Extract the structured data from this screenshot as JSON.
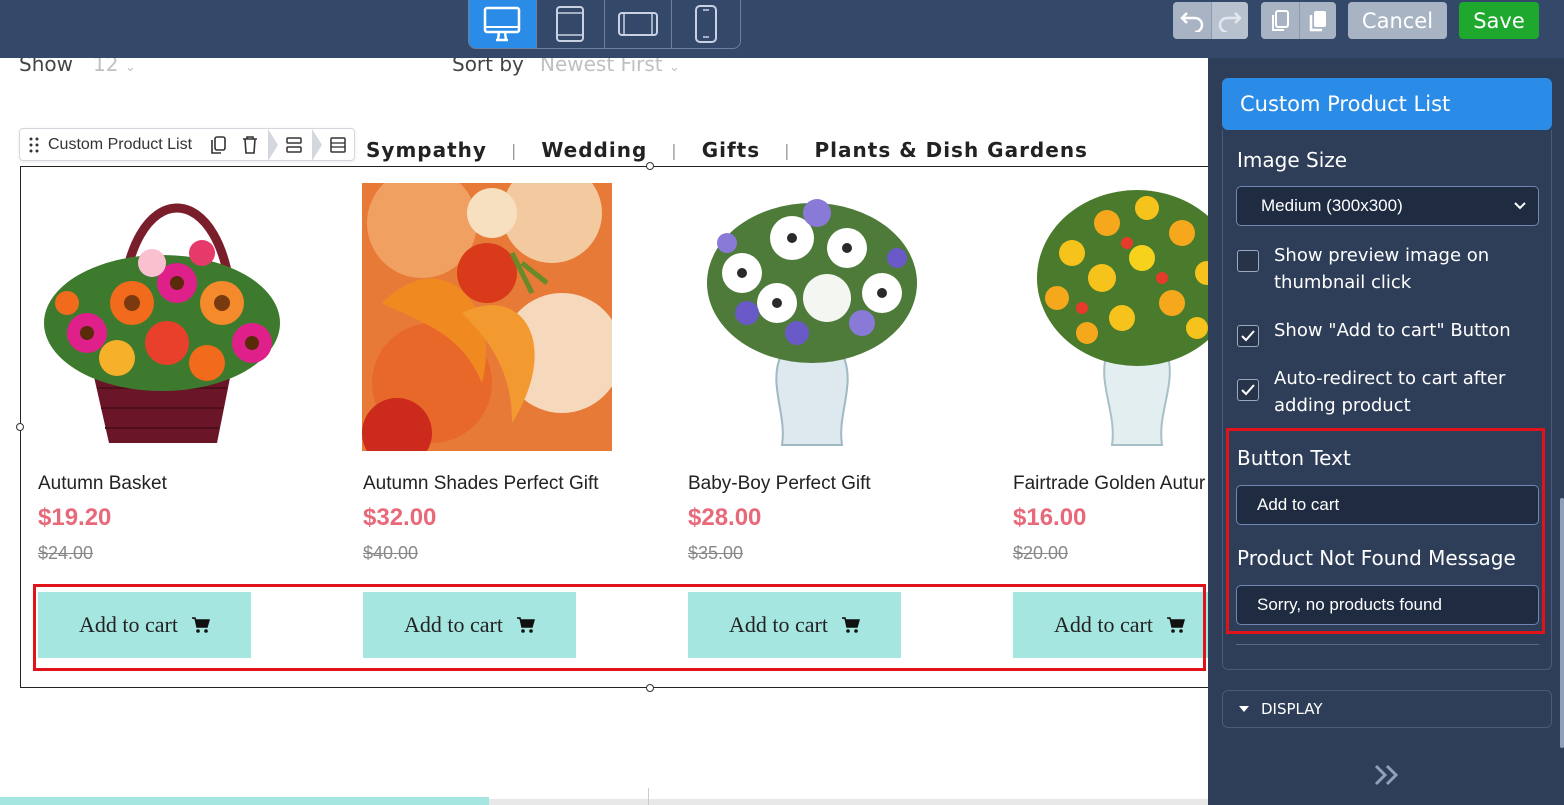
{
  "toolbar": {
    "cancel_label": "Cancel",
    "save_label": "Save"
  },
  "listing": {
    "show_label": "Show",
    "show_value": "12",
    "sort_label": "Sort by",
    "sort_value": "Newest First"
  },
  "categories": [
    "Sympathy",
    "Wedding",
    "Gifts",
    "Plants & Dish Gardens"
  ],
  "widget": {
    "name": "Custom Product List"
  },
  "products": [
    {
      "name": "Autumn Basket",
      "price": "$19.20",
      "old_price": "$24.00",
      "button": "Add to cart"
    },
    {
      "name": "Autumn Shades Perfect Gift",
      "price": "$32.00",
      "old_price": "$40.00",
      "button": "Add to cart"
    },
    {
      "name": "Baby-Boy Perfect Gift",
      "price": "$28.00",
      "old_price": "$35.00",
      "button": "Add to cart"
    },
    {
      "name": "Fairtrade Golden Autur",
      "price": "$16.00",
      "old_price": "$20.00",
      "button": "Add to cart"
    }
  ],
  "panel": {
    "title": "Custom Product List",
    "image_size_label": "Image Size",
    "image_size_value": "Medium (300x300)",
    "checkboxes": [
      {
        "label": "Show preview image on thumbnail click",
        "checked": false
      },
      {
        "label": "Show \"Add to cart\" Button",
        "checked": true
      },
      {
        "label": "Auto-redirect to cart after adding product",
        "checked": true
      }
    ],
    "button_text_label": "Button Text",
    "button_text_value": "Add to cart",
    "not_found_label": "Product Not Found Message",
    "not_found_value": "Sorry, no products found",
    "display_label": "DISPLAY"
  },
  "colors": {
    "topbar": "#34486a",
    "active_device": "#2b8ce8",
    "save_green": "#1fa82e",
    "price_red": "#e8697a",
    "cart_button": "#a6e6e1",
    "highlight_red": "#e0131a"
  }
}
